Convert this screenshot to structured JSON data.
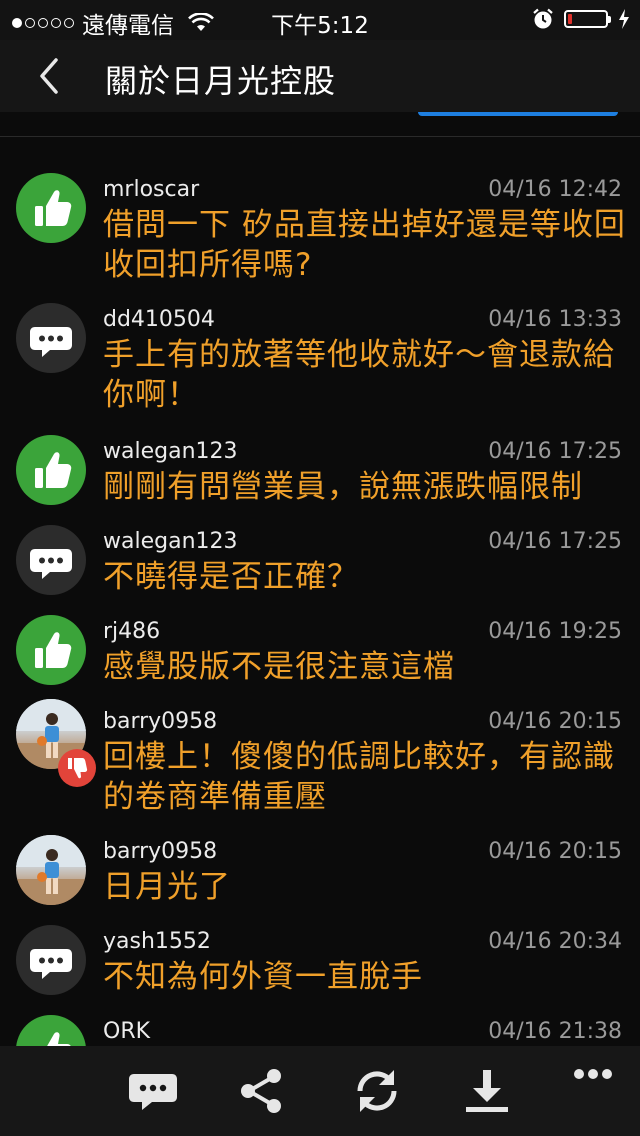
{
  "status_bar": {
    "carrier": "遠傳電信",
    "time": "下午5:12",
    "signal_bars_filled": 1,
    "signal_bars_total": 5,
    "battery_level_percent": 10
  },
  "nav": {
    "title": "關於日月光控股"
  },
  "colors": {
    "background": "#0b0b0b",
    "message_text": "#f0a02a",
    "like_green": "#3ba43a",
    "dislike_red": "#e2443a",
    "accent_blue": "#1e7fe0"
  },
  "posts": [
    {
      "username": "mrloscar",
      "time": "04/16 12:42",
      "message": "借問一下 矽品直接出掉好還是等收回 收回扣所得嗎?",
      "avatar_icon": "thumbs-up-icon"
    },
    {
      "username": "dd410504",
      "time": "04/16 13:33",
      "message": "手上有的放著等他收就好～會退款給你啊！",
      "avatar_icon": "comment-icon"
    },
    {
      "username": "walegan123",
      "time": "04/16 17:25",
      "message": "剛剛有問營業員，說無漲跌幅限制",
      "avatar_icon": "thumbs-up-icon"
    },
    {
      "username": "walegan123",
      "time": "04/16 17:25",
      "message": "不曉得是否正確？",
      "avatar_icon": "comment-icon"
    },
    {
      "username": "rj486",
      "time": "04/16 19:25",
      "message": "感覺股版不是很注意這檔",
      "avatar_icon": "thumbs-up-icon"
    },
    {
      "username": "barry0958",
      "time": "04/16 20:15",
      "message": "回樓上！傻傻的低調比較好，有認識的卷商準備重壓",
      "avatar_icon": "user-photo",
      "badge_icon": "thumbs-down-icon"
    },
    {
      "username": "barry0958",
      "time": "04/16 20:15",
      "message": "日月光了",
      "avatar_icon": "user-photo"
    },
    {
      "username": "yash1552",
      "time": "04/16 20:34",
      "message": "不知為何外資一直脫手",
      "avatar_icon": "comment-icon"
    },
    {
      "username": "ORK",
      "time": "04/16 21:38",
      "message": "",
      "avatar_icon": "thumbs-up-icon"
    }
  ],
  "toolbar": {
    "buttons": [
      "comment-icon",
      "share-icon",
      "refresh-icon",
      "download-icon",
      "more-icon"
    ]
  }
}
